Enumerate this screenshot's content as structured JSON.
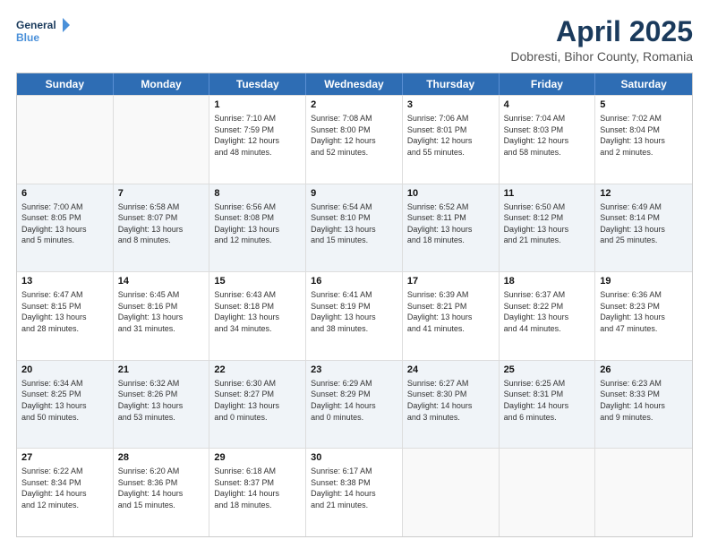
{
  "header": {
    "logo_line1": "General",
    "logo_line2": "Blue",
    "title": "April 2025",
    "subtitle": "Dobresti, Bihor County, Romania"
  },
  "days_of_week": [
    "Sunday",
    "Monday",
    "Tuesday",
    "Wednesday",
    "Thursday",
    "Friday",
    "Saturday"
  ],
  "weeks": [
    [
      {
        "day": "",
        "info": ""
      },
      {
        "day": "",
        "info": ""
      },
      {
        "day": "1",
        "info": "Sunrise: 7:10 AM\nSunset: 7:59 PM\nDaylight: 12 hours\nand 48 minutes."
      },
      {
        "day": "2",
        "info": "Sunrise: 7:08 AM\nSunset: 8:00 PM\nDaylight: 12 hours\nand 52 minutes."
      },
      {
        "day": "3",
        "info": "Sunrise: 7:06 AM\nSunset: 8:01 PM\nDaylight: 12 hours\nand 55 minutes."
      },
      {
        "day": "4",
        "info": "Sunrise: 7:04 AM\nSunset: 8:03 PM\nDaylight: 12 hours\nand 58 minutes."
      },
      {
        "day": "5",
        "info": "Sunrise: 7:02 AM\nSunset: 8:04 PM\nDaylight: 13 hours\nand 2 minutes."
      }
    ],
    [
      {
        "day": "6",
        "info": "Sunrise: 7:00 AM\nSunset: 8:05 PM\nDaylight: 13 hours\nand 5 minutes."
      },
      {
        "day": "7",
        "info": "Sunrise: 6:58 AM\nSunset: 8:07 PM\nDaylight: 13 hours\nand 8 minutes."
      },
      {
        "day": "8",
        "info": "Sunrise: 6:56 AM\nSunset: 8:08 PM\nDaylight: 13 hours\nand 12 minutes."
      },
      {
        "day": "9",
        "info": "Sunrise: 6:54 AM\nSunset: 8:10 PM\nDaylight: 13 hours\nand 15 minutes."
      },
      {
        "day": "10",
        "info": "Sunrise: 6:52 AM\nSunset: 8:11 PM\nDaylight: 13 hours\nand 18 minutes."
      },
      {
        "day": "11",
        "info": "Sunrise: 6:50 AM\nSunset: 8:12 PM\nDaylight: 13 hours\nand 21 minutes."
      },
      {
        "day": "12",
        "info": "Sunrise: 6:49 AM\nSunset: 8:14 PM\nDaylight: 13 hours\nand 25 minutes."
      }
    ],
    [
      {
        "day": "13",
        "info": "Sunrise: 6:47 AM\nSunset: 8:15 PM\nDaylight: 13 hours\nand 28 minutes."
      },
      {
        "day": "14",
        "info": "Sunrise: 6:45 AM\nSunset: 8:16 PM\nDaylight: 13 hours\nand 31 minutes."
      },
      {
        "day": "15",
        "info": "Sunrise: 6:43 AM\nSunset: 8:18 PM\nDaylight: 13 hours\nand 34 minutes."
      },
      {
        "day": "16",
        "info": "Sunrise: 6:41 AM\nSunset: 8:19 PM\nDaylight: 13 hours\nand 38 minutes."
      },
      {
        "day": "17",
        "info": "Sunrise: 6:39 AM\nSunset: 8:21 PM\nDaylight: 13 hours\nand 41 minutes."
      },
      {
        "day": "18",
        "info": "Sunrise: 6:37 AM\nSunset: 8:22 PM\nDaylight: 13 hours\nand 44 minutes."
      },
      {
        "day": "19",
        "info": "Sunrise: 6:36 AM\nSunset: 8:23 PM\nDaylight: 13 hours\nand 47 minutes."
      }
    ],
    [
      {
        "day": "20",
        "info": "Sunrise: 6:34 AM\nSunset: 8:25 PM\nDaylight: 13 hours\nand 50 minutes."
      },
      {
        "day": "21",
        "info": "Sunrise: 6:32 AM\nSunset: 8:26 PM\nDaylight: 13 hours\nand 53 minutes."
      },
      {
        "day": "22",
        "info": "Sunrise: 6:30 AM\nSunset: 8:27 PM\nDaylight: 13 hours\nand 0 minutes."
      },
      {
        "day": "23",
        "info": "Sunrise: 6:29 AM\nSunset: 8:29 PM\nDaylight: 14 hours\nand 0 minutes."
      },
      {
        "day": "24",
        "info": "Sunrise: 6:27 AM\nSunset: 8:30 PM\nDaylight: 14 hours\nand 3 minutes."
      },
      {
        "day": "25",
        "info": "Sunrise: 6:25 AM\nSunset: 8:31 PM\nDaylight: 14 hours\nand 6 minutes."
      },
      {
        "day": "26",
        "info": "Sunrise: 6:23 AM\nSunset: 8:33 PM\nDaylight: 14 hours\nand 9 minutes."
      }
    ],
    [
      {
        "day": "27",
        "info": "Sunrise: 6:22 AM\nSunset: 8:34 PM\nDaylight: 14 hours\nand 12 minutes."
      },
      {
        "day": "28",
        "info": "Sunrise: 6:20 AM\nSunset: 8:36 PM\nDaylight: 14 hours\nand 15 minutes."
      },
      {
        "day": "29",
        "info": "Sunrise: 6:18 AM\nSunset: 8:37 PM\nDaylight: 14 hours\nand 18 minutes."
      },
      {
        "day": "30",
        "info": "Sunrise: 6:17 AM\nSunset: 8:38 PM\nDaylight: 14 hours\nand 21 minutes."
      },
      {
        "day": "",
        "info": ""
      },
      {
        "day": "",
        "info": ""
      },
      {
        "day": "",
        "info": ""
      }
    ]
  ]
}
